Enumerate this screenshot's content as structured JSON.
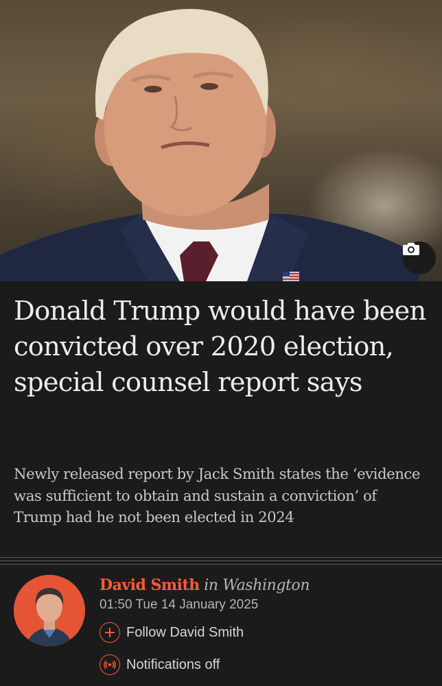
{
  "hero": {
    "camera_icon": "camera-icon"
  },
  "article": {
    "headline": "Donald Trump would have been convicted over 2020 election, special counsel report says",
    "standfirst": "Newly released report by Jack Smith states the ‘evidence was sufficient to obtain and sustain a conviction’ of Trump had he not been elected in 2024"
  },
  "byline": {
    "author": "David Smith",
    "location": " in Washington",
    "datetime": "01:50 Tue 14 January 2025",
    "follow_label": "Follow David Smith",
    "notifications_label": "Notifications off"
  },
  "colors": {
    "background": "#1b1b1b",
    "accent": "#ff5a36",
    "text": "#ededed",
    "muted": "#b5b5b5"
  }
}
